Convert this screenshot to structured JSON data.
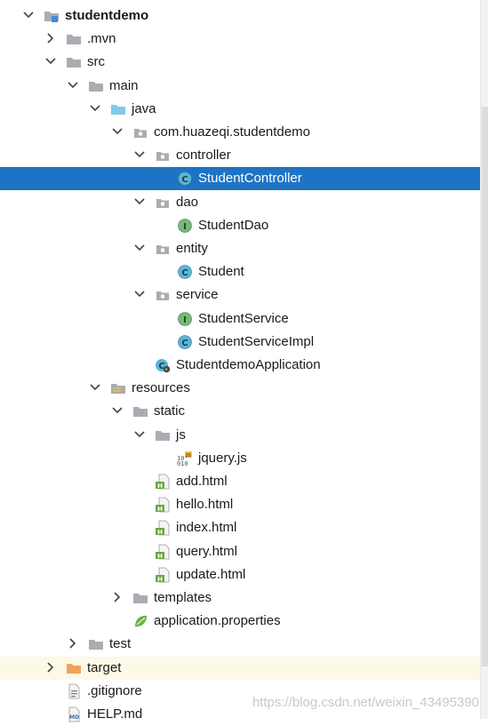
{
  "tree": [
    {
      "label": "studentdemo",
      "depth": 0,
      "arrow": "down",
      "icon": "module-folder-icon",
      "bold": true
    },
    {
      "label": ".mvn",
      "depth": 1,
      "arrow": "right",
      "icon": "folder-icon"
    },
    {
      "label": "src",
      "depth": 1,
      "arrow": "down",
      "icon": "folder-icon"
    },
    {
      "label": "main",
      "depth": 2,
      "arrow": "down",
      "icon": "folder-icon"
    },
    {
      "label": "java",
      "depth": 3,
      "arrow": "down",
      "icon": "source-folder-icon"
    },
    {
      "label": "com.huazeqi.studentdemo",
      "depth": 4,
      "arrow": "down",
      "icon": "package-icon"
    },
    {
      "label": "controller",
      "depth": 5,
      "arrow": "down",
      "icon": "package-icon"
    },
    {
      "label": "StudentController",
      "depth": 6,
      "icon": "class-icon",
      "selected": true
    },
    {
      "label": "dao",
      "depth": 5,
      "arrow": "down",
      "icon": "package-icon"
    },
    {
      "label": "StudentDao",
      "depth": 6,
      "icon": "interface-icon"
    },
    {
      "label": "entity",
      "depth": 5,
      "arrow": "down",
      "icon": "package-icon"
    },
    {
      "label": "Student",
      "depth": 6,
      "icon": "class-icon"
    },
    {
      "label": "service",
      "depth": 5,
      "arrow": "down",
      "icon": "package-icon"
    },
    {
      "label": "StudentService",
      "depth": 6,
      "icon": "interface-icon"
    },
    {
      "label": "StudentServiceImpl",
      "depth": 6,
      "icon": "class-icon"
    },
    {
      "label": "StudentdemoApplication",
      "depth": 5,
      "icon": "spring-boot-class-icon"
    },
    {
      "label": "resources",
      "depth": 3,
      "arrow": "down",
      "icon": "resources-folder-icon"
    },
    {
      "label": "static",
      "depth": 4,
      "arrow": "down",
      "icon": "folder-icon"
    },
    {
      "label": "js",
      "depth": 5,
      "arrow": "down",
      "icon": "folder-icon"
    },
    {
      "label": "jquery.js",
      "depth": 6,
      "icon": "js-file-icon"
    },
    {
      "label": "add.html",
      "depth": 5,
      "icon": "html-file-icon"
    },
    {
      "label": "hello.html",
      "depth": 5,
      "icon": "html-file-icon"
    },
    {
      "label": "index.html",
      "depth": 5,
      "icon": "html-file-icon"
    },
    {
      "label": "query.html",
      "depth": 5,
      "icon": "html-file-icon"
    },
    {
      "label": "update.html",
      "depth": 5,
      "icon": "html-file-icon"
    },
    {
      "label": "templates",
      "depth": 4,
      "arrow": "right",
      "icon": "folder-icon"
    },
    {
      "label": "application.properties",
      "depth": 4,
      "icon": "spring-properties-icon"
    },
    {
      "label": "test",
      "depth": 2,
      "arrow": "right",
      "icon": "folder-icon"
    },
    {
      "label": "target",
      "depth": 1,
      "arrow": "right",
      "icon": "excluded-folder-icon",
      "highlighted": true
    },
    {
      "label": ".gitignore",
      "depth": 1,
      "icon": "text-file-icon"
    },
    {
      "label": "HELP.md",
      "depth": 1,
      "icon": "md-file-icon"
    }
  ],
  "watermark": "https://blog.csdn.net/weixin_43495390",
  "colors": {
    "selection": "#1e74c4",
    "highlight_row": "#fdf9e7",
    "folder": "#a9adb3",
    "source_folder": "#7ecbed",
    "excluded_folder": "#f0a35e",
    "class_badge": "#5ab5d8",
    "interface_badge": "#7cb86b",
    "html_badge": "#6ea648"
  }
}
